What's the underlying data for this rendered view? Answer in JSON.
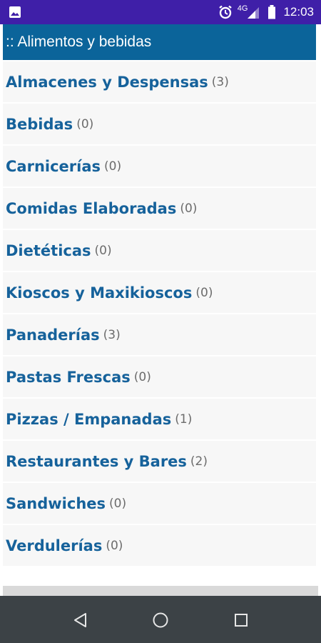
{
  "status_bar": {
    "time": "12:03",
    "network": "4G",
    "icons": [
      "image-icon",
      "alarm-icon",
      "signal-icon",
      "battery-icon"
    ]
  },
  "header": {
    "title": ":: Alimentos y bebidas"
  },
  "categories": [
    {
      "name": "Almacenes y Despensas",
      "count": "(3)"
    },
    {
      "name": "Bebidas",
      "count": "(0)"
    },
    {
      "name": "Carnicerías",
      "count": "(0)"
    },
    {
      "name": "Comidas Elaboradas",
      "count": "(0)"
    },
    {
      "name": "Dietéticas",
      "count": "(0)"
    },
    {
      "name": "Kioscos y Maxikioscos",
      "count": "(0)"
    },
    {
      "name": "Panaderías",
      "count": "(3)"
    },
    {
      "name": "Pastas Frescas",
      "count": "(0)"
    },
    {
      "name": "Pizzas / Empanadas",
      "count": "(1)"
    },
    {
      "name": "Restaurantes y Bares",
      "count": "(2)"
    },
    {
      "name": "Sandwiches",
      "count": "(0)"
    },
    {
      "name": "Verdulerías",
      "count": "(0)"
    }
  ],
  "nav_bar": {
    "buttons": [
      "back-icon",
      "home-icon",
      "recents-icon"
    ]
  },
  "colors": {
    "status_bar": "#3f1fa8",
    "header": "#0b649a",
    "link": "#16629b",
    "count": "#6c6c6c",
    "row_bg": "#f7f7f7",
    "nav_bar": "#3c4246"
  }
}
